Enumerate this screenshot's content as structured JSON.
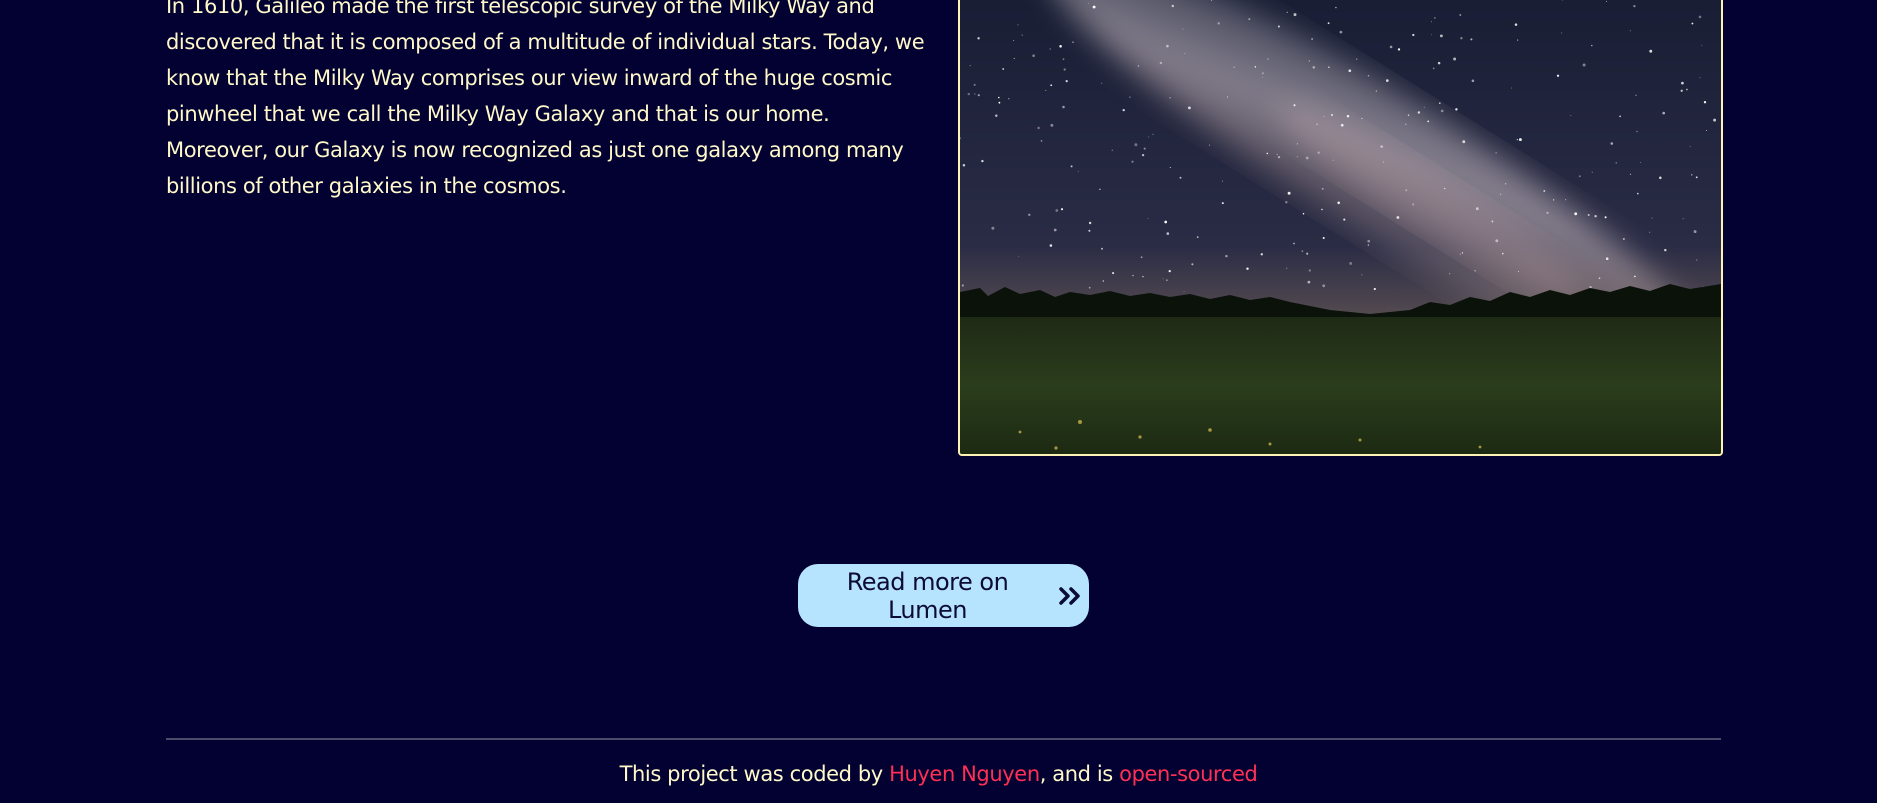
{
  "article": {
    "paragraph": "In 1610, Galileo made the first telescopic survey of the Milky Way and discovered that it is composed of a multitude of individual stars. Today, we know that the Milky Way comprises our view inward of the huge cosmic pinwheel that we call the Milky Way Galaxy and that is our home. Moreover, our Galaxy is now recognized as just one galaxy among many billions of other galaxies in the cosmos."
  },
  "photo": {
    "subject": "milky-way-night-sky-over-meadow"
  },
  "cta": {
    "label": "Read more on Lumen",
    "icon": "double-chevron-right-icon"
  },
  "footer": {
    "prefix": "This project was coded by",
    "author": "Huyen Nguyen",
    "middle": ", and is",
    "link": "open-sourced"
  },
  "colors": {
    "background": "#020131",
    "text": "#fff8c9",
    "accent_link": "#ff2f55",
    "button_bg": "#b6e4ff",
    "button_text": "#0c0b33",
    "frame_border": "#fff2b5"
  }
}
